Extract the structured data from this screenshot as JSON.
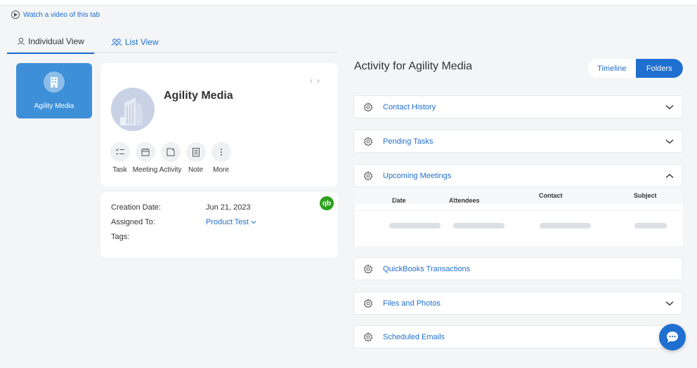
{
  "header": {
    "video_link": "Watch a video of this tab"
  },
  "tabs": [
    {
      "label": "Individual View",
      "active": true
    },
    {
      "label": "List View",
      "active": false
    }
  ],
  "sidebar_card": {
    "name": "Agility Media"
  },
  "profile": {
    "company": "Agility Media",
    "nav_prev": "‹",
    "nav_next": "›",
    "actions": [
      {
        "label": "Task",
        "icon": "task-checklist-icon"
      },
      {
        "label": "Meeting",
        "icon": "calendar-icon"
      },
      {
        "label": "Activity",
        "icon": "activity-icon"
      },
      {
        "label": "Note",
        "icon": "note-icon"
      },
      {
        "label": "More",
        "icon": "more-vertical-icon"
      }
    ]
  },
  "details": {
    "qb_badge": "qb",
    "rows": [
      {
        "key": "Creation Date:",
        "value": "Jun 21, 2023"
      },
      {
        "key": "Assigned To:",
        "value": "Product Test"
      },
      {
        "key": "Tags:",
        "value": ""
      }
    ]
  },
  "activity": {
    "title": "Activity for Agility Media",
    "toggle": [
      {
        "label": "Timeline",
        "active": false
      },
      {
        "label": "Folders",
        "active": true
      }
    ],
    "panels": [
      {
        "title": "Contact History",
        "expanded": false
      },
      {
        "title": "Pending Tasks",
        "expanded": false
      },
      {
        "title": "Upcoming Meetings",
        "expanded": true
      },
      {
        "title": "QuickBooks Transactions",
        "expanded": false
      },
      {
        "title": "Files and Photos",
        "expanded": false
      },
      {
        "title": "Scheduled Emails",
        "expanded": false
      }
    ],
    "meeting_columns": [
      "Date",
      "Attendees",
      "Contact",
      "Subject"
    ]
  },
  "colors": {
    "accent": "#1f6fd0",
    "card_blue": "#3d8fd8",
    "qb_green": "#2ca01c"
  }
}
